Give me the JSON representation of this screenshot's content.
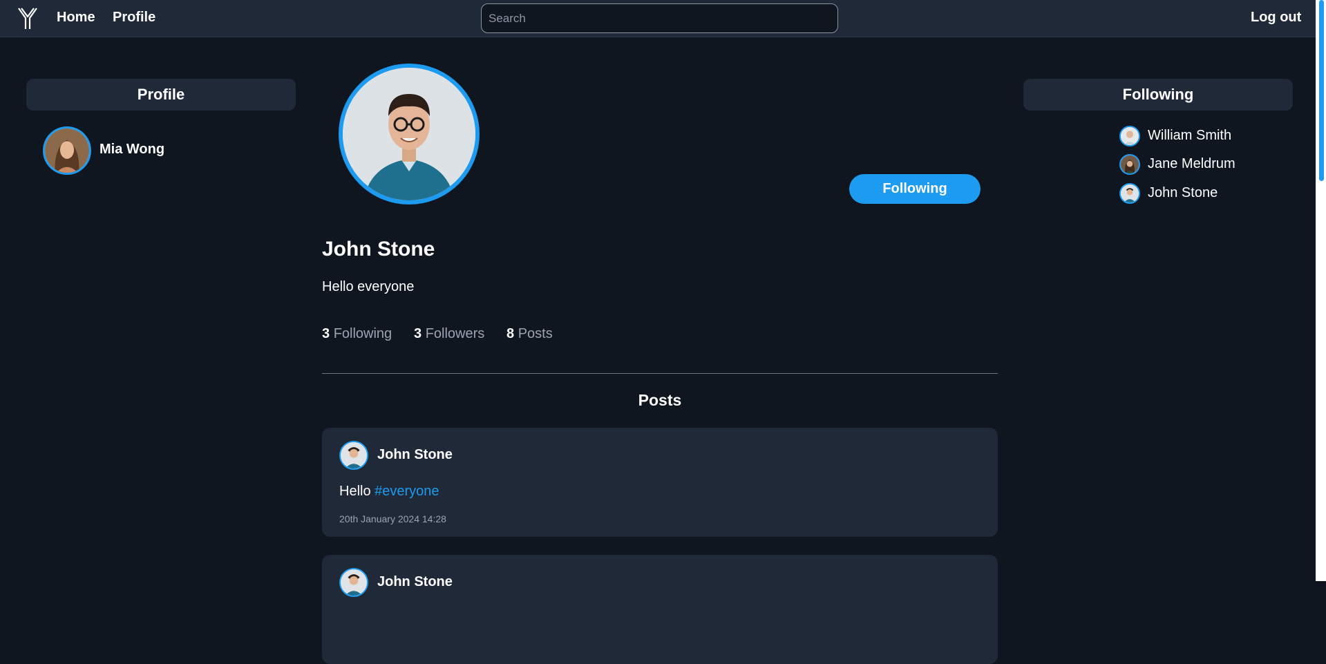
{
  "nav": {
    "home": "Home",
    "profile": "Profile",
    "search_placeholder": "Search",
    "logout": "Log out"
  },
  "sidebar": {
    "title": "Profile",
    "user": {
      "name": "Mia Wong"
    }
  },
  "following_panel": {
    "title": "Following",
    "items": [
      {
        "name": "William Smith"
      },
      {
        "name": "Jane Meldrum"
      },
      {
        "name": "John Stone"
      }
    ]
  },
  "profile": {
    "name": "John Stone",
    "bio": "Hello everyone",
    "follow_button": "Following",
    "stats": {
      "following_count": "3",
      "following_label": "Following",
      "followers_count": "3",
      "followers_label": "Followers",
      "posts_count": "8",
      "posts_label": "Posts"
    }
  },
  "posts": {
    "title": "Posts",
    "items": [
      {
        "author": "John Stone",
        "text": "Hello",
        "hashtag": "#everyone",
        "timestamp": "20th January 2024 14:28"
      },
      {
        "author": "John Stone"
      }
    ]
  },
  "colors": {
    "background": "#0f1620",
    "panel": "#1f2937",
    "accent": "#1d9bf0",
    "muted_text": "#9aa5b1"
  },
  "icons": [
    "y-logo-icon",
    "avatar-image"
  ]
}
